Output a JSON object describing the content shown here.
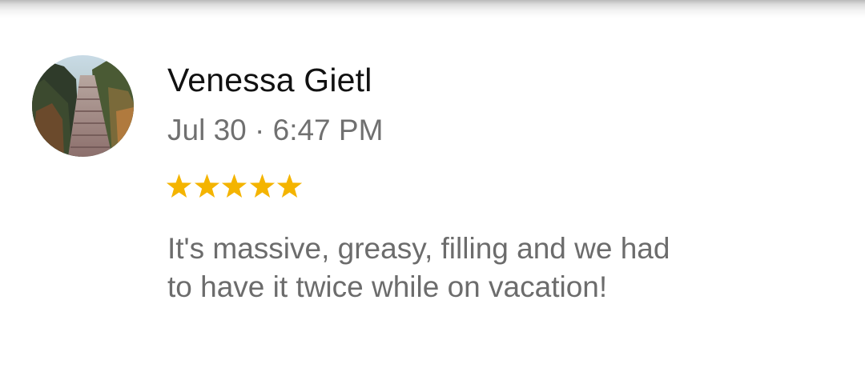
{
  "review": {
    "reviewer_name": "Venessa Gietl",
    "timestamp": "Jul 30 · 6:47 PM",
    "rating": 5,
    "rating_max": 5,
    "text": "It's massive, greasy, filling and we had to have it twice while on vacation!"
  },
  "icons": {
    "star": "star-icon",
    "avatar": "profile-photo"
  },
  "colors": {
    "star": "#F4B400",
    "name": "#111111",
    "secondary_text": "#707070",
    "body_text": "#6c6c6c"
  }
}
